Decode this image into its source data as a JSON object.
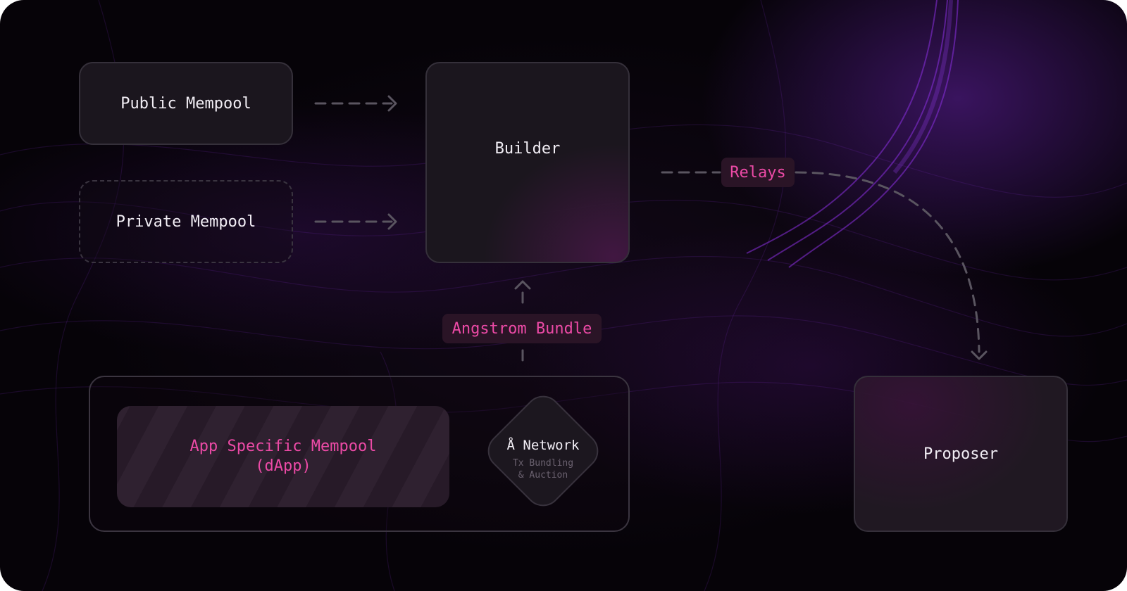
{
  "nodes": {
    "public_mempool": "Public Mempool",
    "private_mempool": "Private Mempool",
    "builder": "Builder",
    "proposer": "Proposer",
    "app_mempool_line1": "App Specific Mempool",
    "app_mempool_line2": "(dApp)",
    "network_title": "Å Network",
    "network_subtitle": "Tx Bundling\n& Auction"
  },
  "edges": {
    "relays": "Relays",
    "angstrom_bundle": "Angstrom Bundle"
  },
  "colors": {
    "accent": "#ec4aa6",
    "node_fill": "#1b161e",
    "node_border": "#35303a",
    "connector": "#5a5560"
  }
}
